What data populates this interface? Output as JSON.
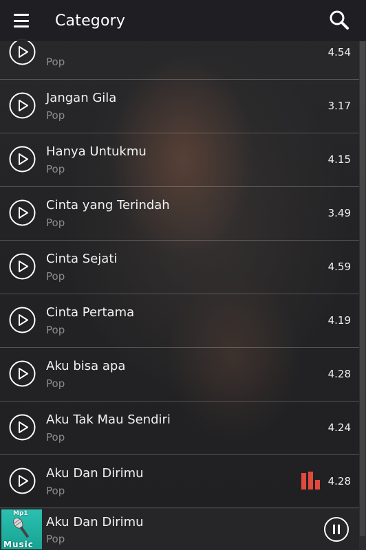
{
  "header": {
    "title": "Category",
    "menu_icon": "hamburger-menu-icon",
    "search_icon": "search-icon"
  },
  "songs": [
    {
      "name": "",
      "genre": "Pop",
      "duration": "4.54"
    },
    {
      "name": "Jangan Gila",
      "genre": "Pop",
      "duration": "3.17"
    },
    {
      "name": "Hanya Untukmu",
      "genre": "Pop",
      "duration": "4.15"
    },
    {
      "name": "Cinta yang Terindah",
      "genre": "Pop",
      "duration": "3.49"
    },
    {
      "name": "Cinta Sejati",
      "genre": "Pop",
      "duration": "4.59"
    },
    {
      "name": "Cinta Pertama",
      "genre": "Pop",
      "duration": "4.19"
    },
    {
      "name": "Aku bisa apa",
      "genre": "Pop",
      "duration": "4.28"
    },
    {
      "name": "Aku Tak Mau Sendiri",
      "genre": "Pop",
      "duration": "4.24"
    },
    {
      "name": "Aku Dan Dirimu",
      "genre": "Pop",
      "duration": "4.28",
      "playing": true
    }
  ],
  "now_playing": {
    "cover_text_top": "Mp1",
    "cover_text_bottom": "Music",
    "name": "Aku Dan Dirimu",
    "genre": "Pop",
    "control_icon": "pause-icon"
  },
  "colors": {
    "equalizer": "#e04a3c",
    "cover_bg": "#22b3a4"
  }
}
